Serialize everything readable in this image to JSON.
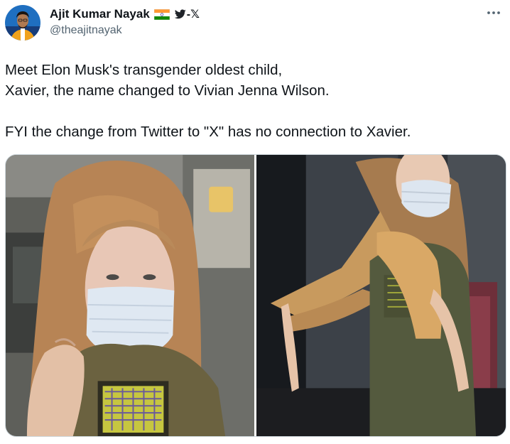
{
  "author": {
    "display_name": "Ajit Kumar Nayak",
    "name_suffix": "-𝕏",
    "handle": "@theajitnayak",
    "flag_icon": "india-flag-icon",
    "bird_icon": "twitter-bird-icon"
  },
  "menu": {
    "more_icon": "more-horizontal-icon"
  },
  "tweet": {
    "text": "Meet Elon Musk's transgender oldest child,\nXavier, the name changed to Vivian Jenna Wilson.\n\nFYI the change from Twitter to \"X\" has no connection to Xavier."
  },
  "media": {
    "count": 2,
    "photos": [
      {
        "name": "photo-1"
      },
      {
        "name": "photo-2"
      }
    ]
  },
  "colors": {
    "text": "#0f1419",
    "secondary": "#536471",
    "bird": "#1d9bf0",
    "border": "#cfd9de"
  }
}
